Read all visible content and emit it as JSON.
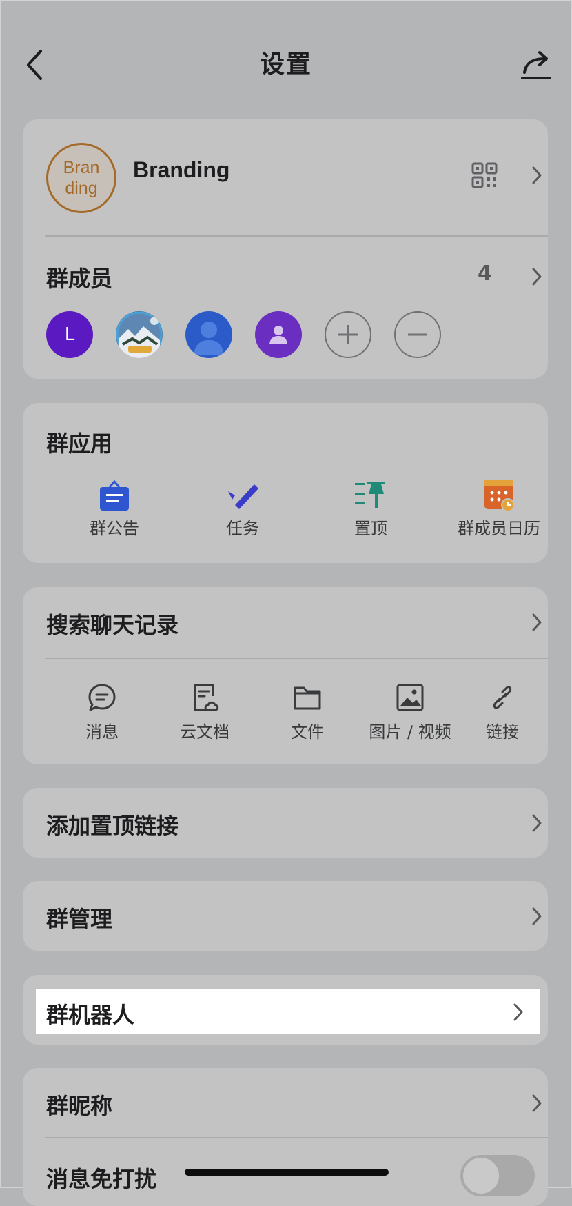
{
  "header": {
    "title": "设置"
  },
  "group": {
    "logo_line1": "Bran",
    "logo_line2": "ding",
    "name": "Branding"
  },
  "members": {
    "label": "群成员",
    "count": "4",
    "avatars": [
      {
        "initial": "L",
        "color": "#5b19c2"
      },
      {
        "kind": "photo"
      },
      {
        "kind": "person",
        "color": "#2b5bc9"
      },
      {
        "kind": "person",
        "color": "#6a2fc0"
      }
    ]
  },
  "apps": {
    "label": "群应用",
    "items": [
      {
        "label": "群公告",
        "icon": "announcement-icon",
        "color": "#2f56d1"
      },
      {
        "label": "任务",
        "icon": "task-check-icon",
        "color": "#3b3dc9"
      },
      {
        "label": "置顶",
        "icon": "pin-icon",
        "color": "#1e8a77"
      },
      {
        "label": "群成员日历",
        "icon": "calendar-icon",
        "color": "#d8642a"
      }
    ]
  },
  "search": {
    "label": "搜索聊天记录",
    "tools": [
      {
        "label": "消息",
        "icon": "message-icon"
      },
      {
        "label": "云文档",
        "icon": "cloud-doc-icon"
      },
      {
        "label": "文件",
        "icon": "folder-icon"
      },
      {
        "label": "图片 / 视频",
        "icon": "image-icon"
      },
      {
        "label": "链接",
        "icon": "link-icon"
      }
    ]
  },
  "rows": {
    "pin_link": "添加置顶链接",
    "manage": "群管理",
    "bots": "群机器人",
    "nickname": "群昵称",
    "dnd": "消息免打扰"
  }
}
